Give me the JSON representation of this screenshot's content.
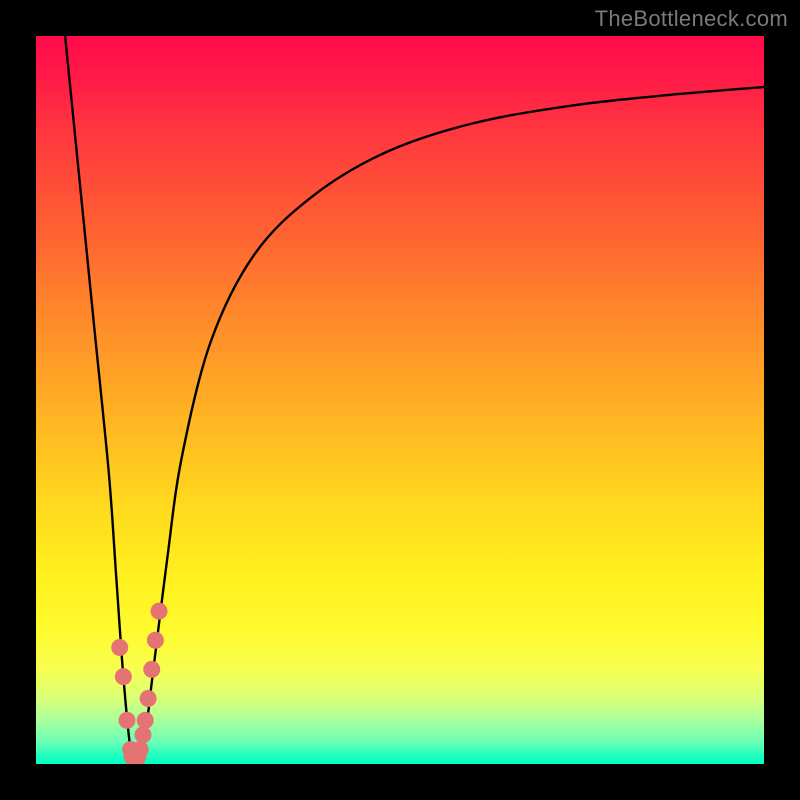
{
  "watermark": "TheBottleneck.com",
  "chart_data": {
    "type": "line",
    "title": "",
    "xlabel": "",
    "ylabel": "",
    "xlim": [
      0,
      100
    ],
    "ylim": [
      0,
      100
    ],
    "grid": false,
    "legend": false,
    "series": [
      {
        "name": "bottleneck-curve",
        "color": "#000000",
        "x": [
          4,
          6,
          8,
          10,
          11,
          12,
          13,
          14,
          15,
          16,
          18,
          20,
          24,
          30,
          38,
          48,
          60,
          74,
          88,
          100
        ],
        "y": [
          100,
          80,
          60,
          40,
          26,
          12,
          2,
          0,
          4,
          12,
          28,
          42,
          58,
          70,
          78,
          84,
          88,
          90.5,
          92,
          93
        ]
      },
      {
        "name": "dip-markers",
        "type": "scatter",
        "color": "#e57373",
        "x": [
          11.5,
          12,
          12.5,
          13,
          13.2,
          13.5,
          13.7,
          14,
          14.3,
          14.7,
          15,
          15.4,
          15.9,
          16.4,
          16.9
        ],
        "y": [
          16,
          12,
          6,
          2,
          1,
          0.5,
          0.5,
          1,
          2,
          4,
          6,
          9,
          13,
          17,
          21
        ]
      }
    ],
    "background_gradient": {
      "top": "#ff0a4a",
      "mid": "#fff01e",
      "bottom": "#00ffc5"
    }
  }
}
